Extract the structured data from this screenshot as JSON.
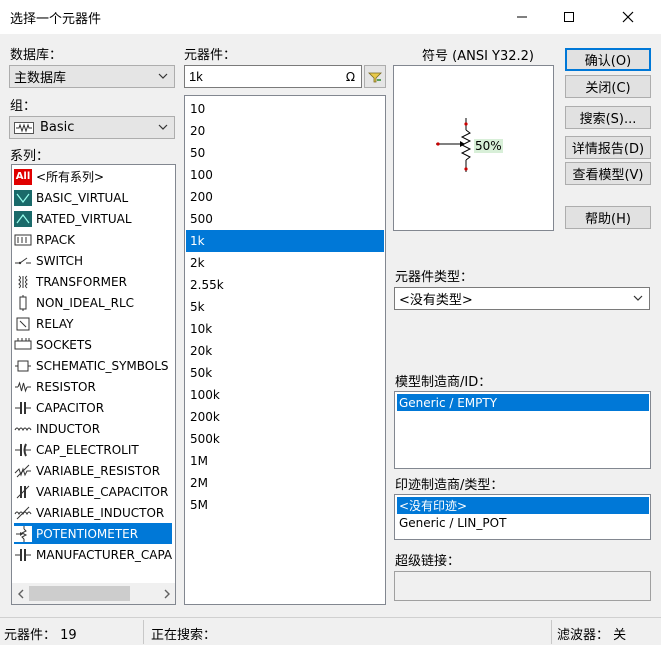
{
  "window": {
    "title": "选择一个元器件"
  },
  "left": {
    "database_label": "数据库：",
    "database_value": "主数据库",
    "group_label": "组：",
    "group_value": "Basic",
    "family_label": "系列：",
    "families": [
      {
        "label": "<所有系列>",
        "icon": "all-icon"
      },
      {
        "label": "BASIC_VIRTUAL",
        "icon": "basic-virtual-icon"
      },
      {
        "label": "RATED_VIRTUAL",
        "icon": "rated-virtual-icon"
      },
      {
        "label": "RPACK",
        "icon": "rpack-icon"
      },
      {
        "label": "SWITCH",
        "icon": "switch-icon"
      },
      {
        "label": "TRANSFORMER",
        "icon": "transformer-icon"
      },
      {
        "label": "NON_IDEAL_RLC",
        "icon": "non-ideal-rlc-icon"
      },
      {
        "label": "RELAY",
        "icon": "relay-icon"
      },
      {
        "label": "SOCKETS",
        "icon": "sockets-icon"
      },
      {
        "label": "SCHEMATIC_SYMBOLS",
        "icon": "schematic-symbols-icon"
      },
      {
        "label": "RESISTOR",
        "icon": "resistor-icon"
      },
      {
        "label": "CAPACITOR",
        "icon": "capacitor-icon"
      },
      {
        "label": "INDUCTOR",
        "icon": "inductor-icon"
      },
      {
        "label": "CAP_ELECTROLIT",
        "icon": "cap-electrolit-icon"
      },
      {
        "label": "VARIABLE_RESISTOR",
        "icon": "variable-resistor-icon"
      },
      {
        "label": "VARIABLE_CAPACITOR",
        "icon": "variable-capacitor-icon"
      },
      {
        "label": "VARIABLE_INDUCTOR",
        "icon": "variable-inductor-icon"
      },
      {
        "label": "POTENTIOMETER",
        "icon": "potentiometer-icon",
        "selected": true
      },
      {
        "label": "MANUFACTURER_CAPACITOR",
        "icon": "manufacturer-capacitor-icon"
      }
    ]
  },
  "middle": {
    "component_label": "元器件：",
    "search_value": "1k",
    "components": [
      "10",
      "20",
      "50",
      "100",
      "200",
      "500",
      "1k",
      "2k",
      "2.55k",
      "5k",
      "10k",
      "20k",
      "50k",
      "100k",
      "200k",
      "500k",
      "1M",
      "2M",
      "5M"
    ],
    "selected_component": "1k"
  },
  "right": {
    "symbol_label": "符号 (ANSI Y32.2)",
    "symbol_percent": "50%",
    "component_type_label": "元器件类型：",
    "component_type_value": "<没有类型>",
    "model_label": "模型制造商/ID：",
    "models": [
      "Generic / EMPTY"
    ],
    "footprint_label": "印迹制造商/类型：",
    "footprints": [
      "<没有印迹>",
      "Generic / LIN_POT"
    ],
    "hyperlink_label": "超级链接：",
    "hyperlink_value": ""
  },
  "buttons": {
    "ok": "确认(O)",
    "close": "关闭(C)",
    "search": "搜索(S)...",
    "report": "详情报告(D)",
    "view_model": "查看模型(V)",
    "help": "帮助(H)"
  },
  "status": {
    "component_count": "元器件：  19",
    "searching": "正在搜索：",
    "filter": "滤波器：  关"
  }
}
